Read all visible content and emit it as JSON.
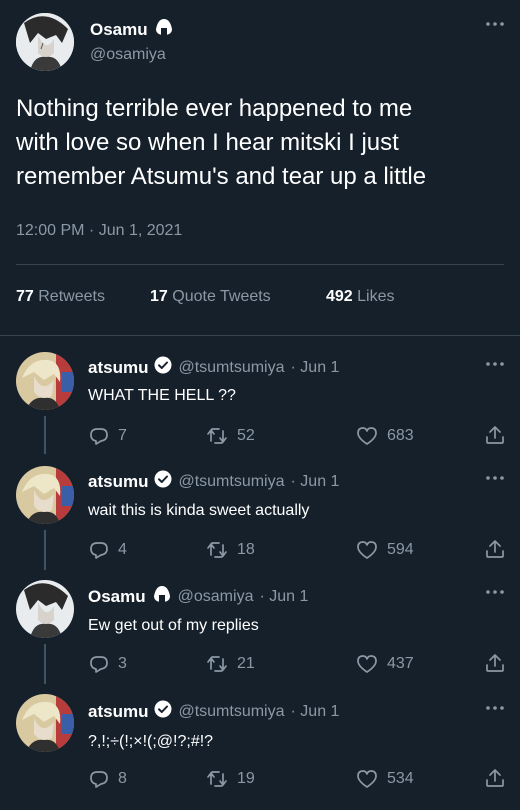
{
  "main_tweet": {
    "author_name": "Osamu",
    "author_handle": "@osamiya",
    "text_line1": "Nothing terrible ever happened to me",
    "text_line2": "with love so when I hear mitski I just",
    "text_line3": "remember Atsumu's and tear up a little",
    "timestamp": "12:00 PM · Jun 1, 2021",
    "retweets_count": "77",
    "retweets_label": "Retweets",
    "quotes_count": "17",
    "quotes_label": "Quote Tweets",
    "likes_count": "492",
    "likes_label": "Likes"
  },
  "replies": [
    {
      "name": "atsumu",
      "handle": "@tsumtsumiya",
      "date": "· Jun 1",
      "text": "WHAT THE HELL ??",
      "replies": "7",
      "retweets": "52",
      "likes": "683",
      "verified": true
    },
    {
      "name": "atsumu",
      "handle": "@tsumtsumiya",
      "date": "· Jun 1",
      "text": "wait this is kinda sweet actually",
      "replies": "4",
      "retweets": "18",
      "likes": "594",
      "verified": true
    },
    {
      "name": "Osamu",
      "handle": "@osamiya",
      "date": "· Jun 1",
      "text": "Ew get out of my replies",
      "replies": "3",
      "retweets": "21",
      "likes": "437",
      "verified": false
    },
    {
      "name": "atsumu",
      "handle": "@tsumtsumiya",
      "date": "· Jun 1",
      "text": "?,!;÷(!;×!(;@!?;#!?",
      "replies": "8",
      "retweets": "19",
      "likes": "534",
      "verified": true
    }
  ],
  "icons": [
    "more-icon",
    "onigiri-icon",
    "verified-icon",
    "reply-icon",
    "retweet-icon",
    "like-icon",
    "share-icon"
  ],
  "colors": {
    "background": "#15202b",
    "muted": "#8b98a5",
    "divider": "#38444d"
  }
}
